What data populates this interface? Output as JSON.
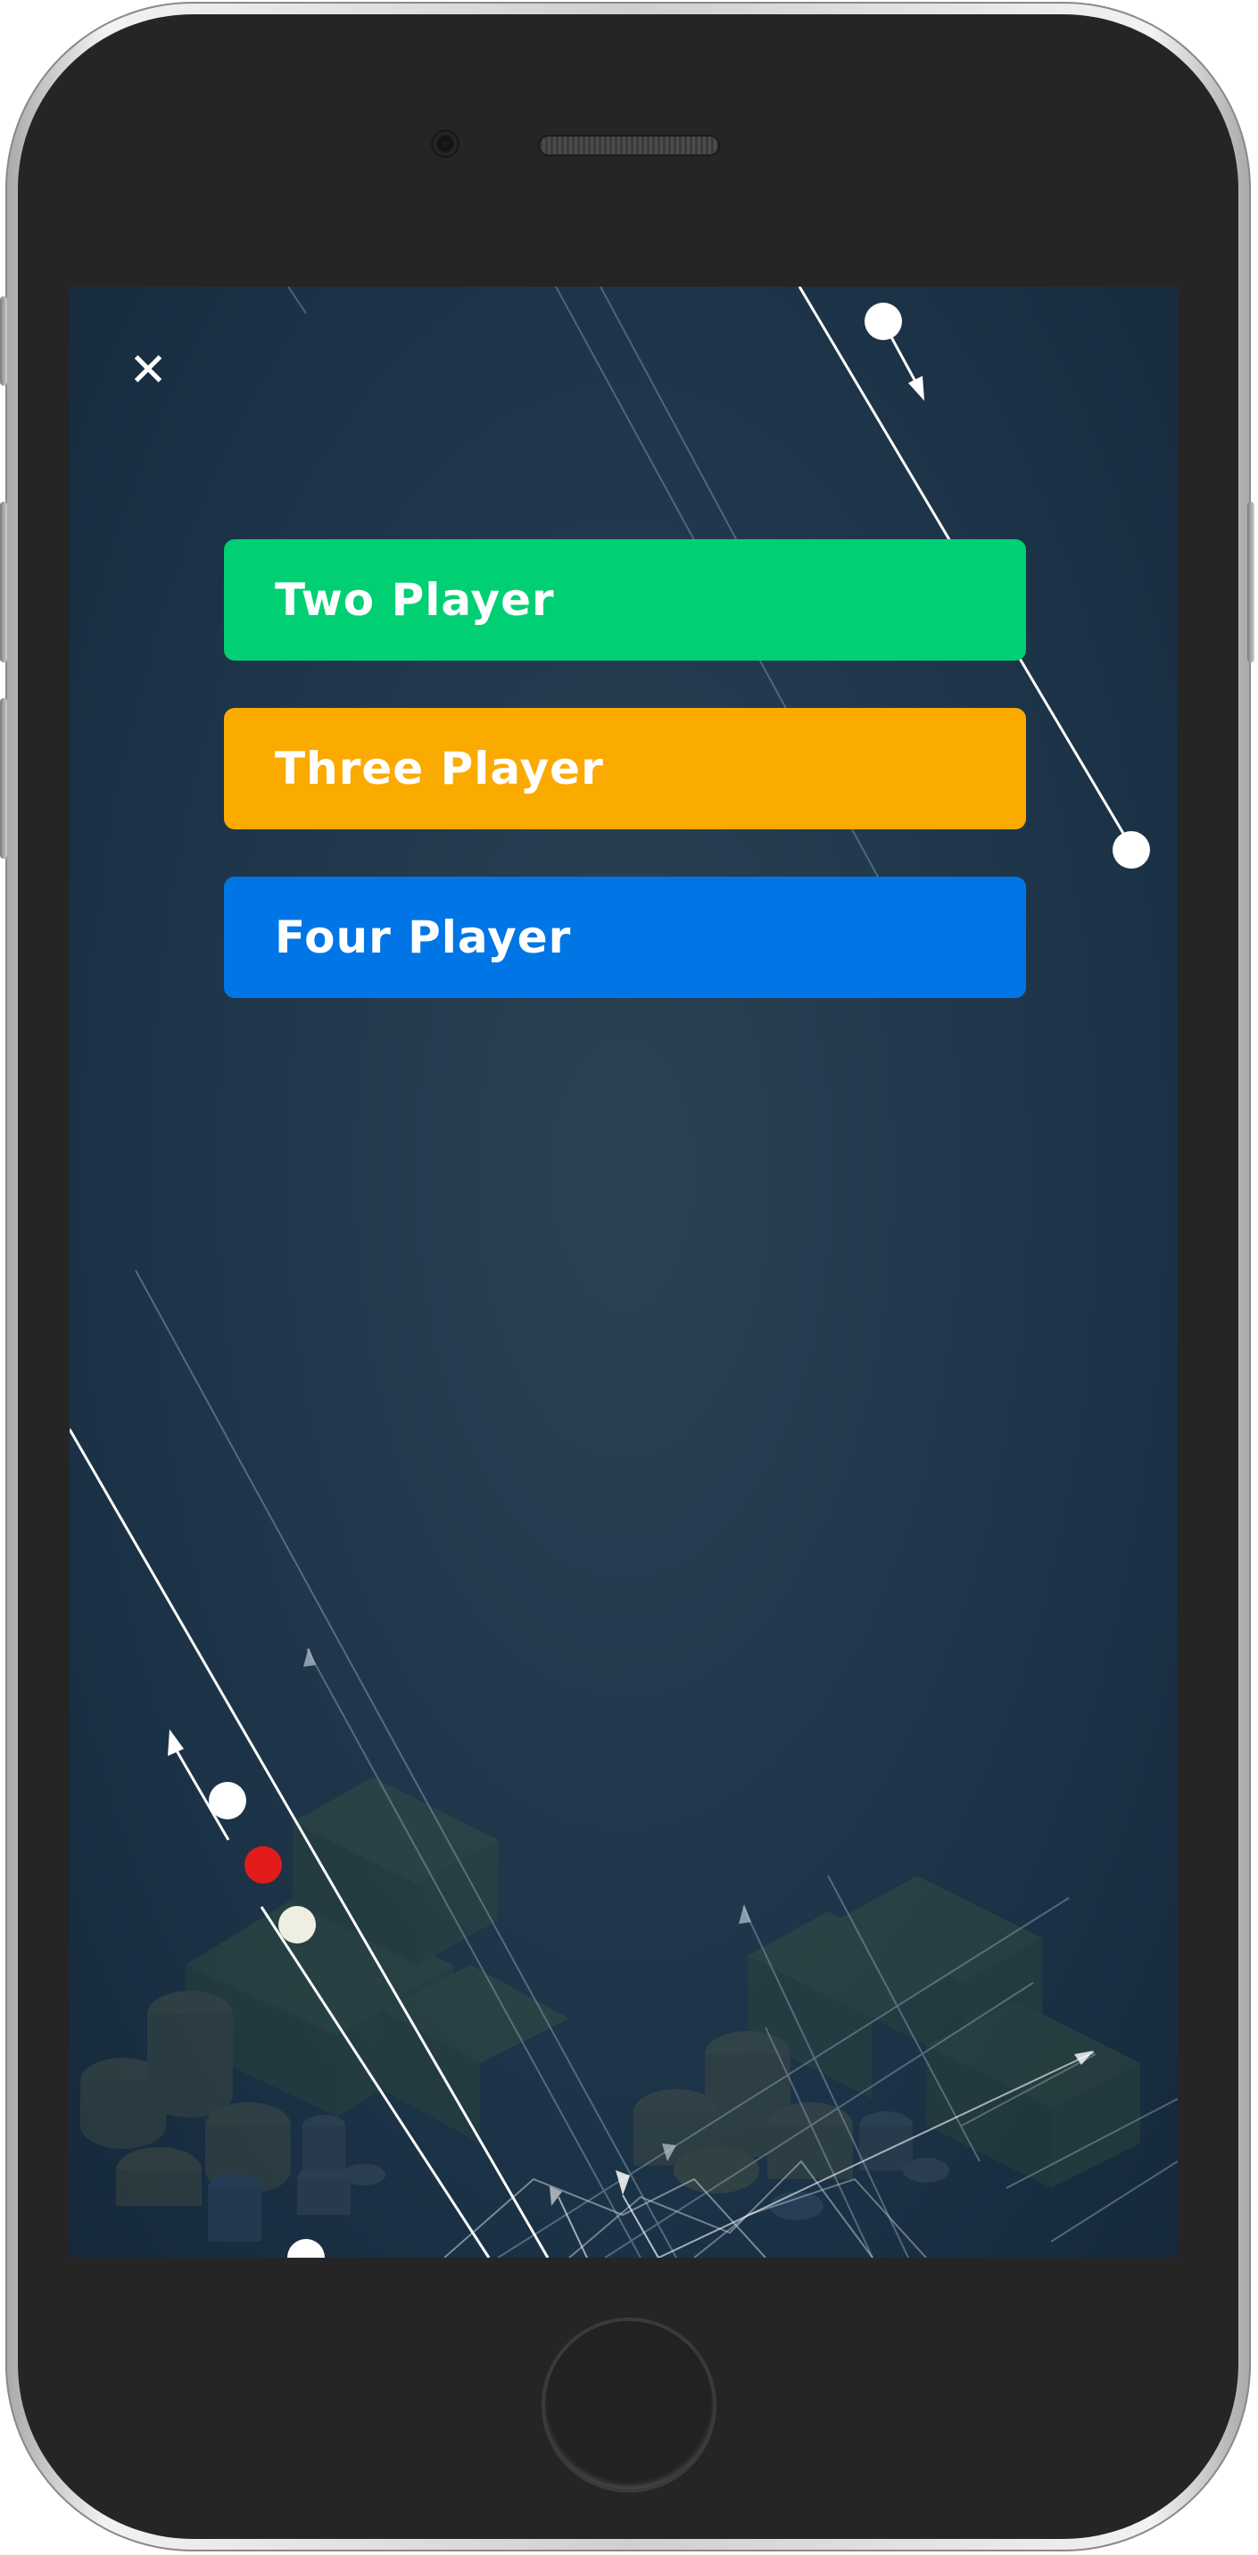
{
  "close": {
    "glyph": "✕",
    "icon": "close-icon"
  },
  "menu": {
    "two_player": {
      "label": "Two Player",
      "color": "#00cf74"
    },
    "three_player": {
      "label": "Three Player",
      "color": "#fbaa00"
    },
    "four_player": {
      "label": "Four Player",
      "color": "#0076e6"
    }
  },
  "theme": {
    "background": "#1e3448",
    "accent_red": "#e21b1b"
  }
}
